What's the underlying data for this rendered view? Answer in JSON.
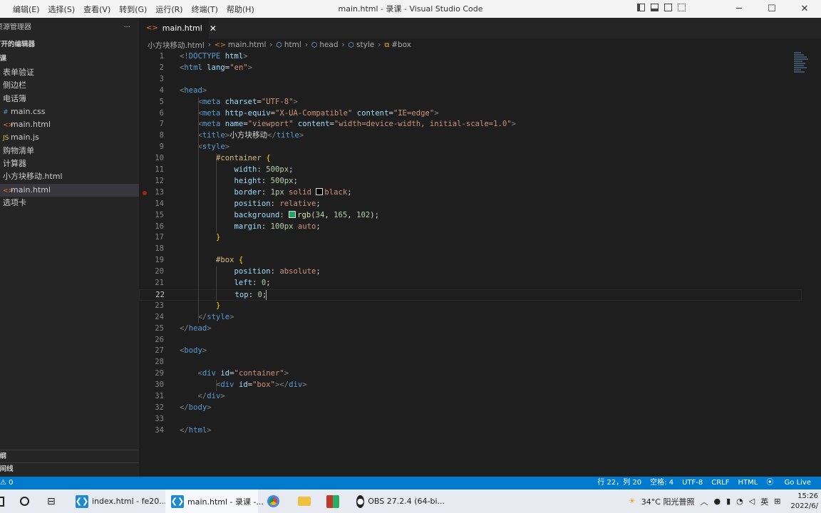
{
  "window": {
    "title": "main.html - 录课 - Visual Studio Code",
    "menu": [
      "编辑(E)",
      "选择(S)",
      "查看(V)",
      "转到(G)",
      "运行(R)",
      "终端(T)",
      "帮助(H)"
    ]
  },
  "explorer": {
    "header": "资源管理器",
    "more": "···",
    "open_editors": "打开的编辑器",
    "folder": "录课",
    "items": [
      {
        "label": "表单验证",
        "icon": "",
        "color": "#cccccc"
      },
      {
        "label": "侧边栏",
        "icon": "",
        "color": "#cccccc"
      },
      {
        "label": "电话簿",
        "icon": "",
        "color": "#cccccc"
      },
      {
        "label": "main.css",
        "icon": "#",
        "color": "#519aba"
      },
      {
        "label": "main.html",
        "icon": "<>",
        "color": "#e37933"
      },
      {
        "label": "main.js",
        "icon": "JS",
        "color": "#cbcb41"
      },
      {
        "label": "购物清单",
        "icon": "",
        "color": "#cccccc"
      },
      {
        "label": "计算器",
        "icon": "",
        "color": "#cccccc"
      },
      {
        "label": "小方块移动.html",
        "icon": "",
        "color": "#cccccc"
      },
      {
        "label": "main.html",
        "icon": "<>",
        "color": "#e37933"
      },
      {
        "label": "选项卡",
        "icon": "",
        "color": "#cccccc"
      }
    ],
    "selected_index": 9,
    "outline": "大纲",
    "timeline": "时间线"
  },
  "tabs": [
    {
      "label": "main.html",
      "close": "✕"
    }
  ],
  "breadcrumb": [
    "小方块移动.html",
    "main.html",
    "html",
    "head",
    "style",
    "#box"
  ],
  "editor": {
    "current_line": 22,
    "breakpoint_line": 13,
    "lines": [
      [
        [
          "t-br",
          "<!"
        ],
        [
          "t-tag",
          "DOCTYPE "
        ],
        [
          "t-attr",
          "html"
        ],
        [
          "t-br",
          ">"
        ]
      ],
      [
        [
          "t-br",
          "<"
        ],
        [
          "t-tag",
          "html "
        ],
        [
          "t-attr",
          "lang"
        ],
        [
          "t-p",
          "="
        ],
        [
          "t-str",
          "\"en\""
        ],
        [
          "t-br",
          ">"
        ]
      ],
      [],
      [
        [
          "t-br",
          "<"
        ],
        [
          "t-tag",
          "head"
        ],
        [
          "t-br",
          ">"
        ]
      ],
      [
        [
          "t-p",
          "    "
        ],
        [
          "t-br",
          "<"
        ],
        [
          "t-tag",
          "meta "
        ],
        [
          "t-attr",
          "charset"
        ],
        [
          "t-p",
          "="
        ],
        [
          "t-str",
          "\"UTF-8\""
        ],
        [
          "t-br",
          ">"
        ]
      ],
      [
        [
          "t-p",
          "    "
        ],
        [
          "t-br",
          "<"
        ],
        [
          "t-tag",
          "meta "
        ],
        [
          "t-attr",
          "http-equiv"
        ],
        [
          "t-p",
          "="
        ],
        [
          "t-str",
          "\"X-UA-Compatible\""
        ],
        [
          "t-p",
          " "
        ],
        [
          "t-attr",
          "content"
        ],
        [
          "t-p",
          "="
        ],
        [
          "t-str",
          "\"IE=edge\""
        ],
        [
          "t-br",
          ">"
        ]
      ],
      [
        [
          "t-p",
          "    "
        ],
        [
          "t-br",
          "<"
        ],
        [
          "t-tag",
          "meta "
        ],
        [
          "t-attr",
          "name"
        ],
        [
          "t-p",
          "="
        ],
        [
          "t-str",
          "\"viewport\""
        ],
        [
          "t-p",
          " "
        ],
        [
          "t-attr",
          "content"
        ],
        [
          "t-p",
          "="
        ],
        [
          "t-str",
          "\"width=device-width, initial-scale=1.0\""
        ],
        [
          "t-br",
          ">"
        ]
      ],
      [
        [
          "t-p",
          "    "
        ],
        [
          "t-br",
          "<"
        ],
        [
          "t-tag",
          "title"
        ],
        [
          "t-br",
          ">"
        ],
        [
          "t-txt",
          "小方块移动"
        ],
        [
          "t-br",
          "</"
        ],
        [
          "t-tag",
          "title"
        ],
        [
          "t-br",
          ">"
        ]
      ],
      [
        [
          "t-p",
          "    "
        ],
        [
          "t-br",
          "<"
        ],
        [
          "t-tag",
          "style"
        ],
        [
          "t-br",
          ">"
        ]
      ],
      [
        [
          "t-p",
          "        "
        ],
        [
          "t-sel",
          "#container "
        ],
        [
          "t-curly",
          "{"
        ]
      ],
      [
        [
          "t-p",
          "            "
        ],
        [
          "t-prop",
          "width"
        ],
        [
          "t-p",
          ": "
        ],
        [
          "t-num",
          "500px"
        ],
        [
          "t-p",
          ";"
        ]
      ],
      [
        [
          "t-p",
          "            "
        ],
        [
          "t-prop",
          "height"
        ],
        [
          "t-p",
          ": "
        ],
        [
          "t-num",
          "500px"
        ],
        [
          "t-p",
          ";"
        ]
      ],
      [
        [
          "t-p",
          "            "
        ],
        [
          "t-prop",
          "border"
        ],
        [
          "t-p",
          ": "
        ],
        [
          "t-num",
          "1px "
        ],
        [
          "t-val",
          "solid "
        ],
        [
          "sw-black",
          ""
        ],
        [
          "t-val",
          "black"
        ],
        [
          "t-p",
          ";"
        ]
      ],
      [
        [
          "t-p",
          "            "
        ],
        [
          "t-prop",
          "position"
        ],
        [
          "t-p",
          ": "
        ],
        [
          "t-val",
          "relative"
        ],
        [
          "t-p",
          ";"
        ]
      ],
      [
        [
          "t-p",
          "            "
        ],
        [
          "t-prop",
          "background"
        ],
        [
          "t-p",
          ": "
        ],
        [
          "sw-green",
          ""
        ],
        [
          "t-fn",
          "rgb"
        ],
        [
          "t-p",
          "("
        ],
        [
          "t-num",
          "34"
        ],
        [
          "t-p",
          ", "
        ],
        [
          "t-num",
          "165"
        ],
        [
          "t-p",
          ", "
        ],
        [
          "t-num",
          "102"
        ],
        [
          "t-p",
          ");"
        ]
      ],
      [
        [
          "t-p",
          "            "
        ],
        [
          "t-prop",
          "margin"
        ],
        [
          "t-p",
          ": "
        ],
        [
          "t-num",
          "100px "
        ],
        [
          "t-val",
          "auto"
        ],
        [
          "t-p",
          ";"
        ]
      ],
      [
        [
          "t-p",
          "        "
        ],
        [
          "t-curly",
          "}"
        ]
      ],
      [],
      [
        [
          "t-p",
          "        "
        ],
        [
          "t-sel",
          "#box "
        ],
        [
          "t-curly",
          "{"
        ]
      ],
      [
        [
          "t-p",
          "            "
        ],
        [
          "t-prop",
          "position"
        ],
        [
          "t-p",
          ": "
        ],
        [
          "t-val",
          "absolute"
        ],
        [
          "t-p",
          ";"
        ]
      ],
      [
        [
          "t-p",
          "            "
        ],
        [
          "t-prop",
          "left"
        ],
        [
          "t-p",
          ": "
        ],
        [
          "t-num",
          "0"
        ],
        [
          "t-p",
          ";"
        ]
      ],
      [
        [
          "t-p",
          "            "
        ],
        [
          "t-prop",
          "top"
        ],
        [
          "t-p",
          ": "
        ],
        [
          "t-num",
          "0"
        ],
        [
          "t-p",
          ";"
        ]
      ],
      [
        [
          "t-p",
          "        "
        ],
        [
          "t-curly",
          "}"
        ]
      ],
      [
        [
          "t-p",
          "    "
        ],
        [
          "t-br",
          "</"
        ],
        [
          "t-tag",
          "style"
        ],
        [
          "t-br",
          ">"
        ]
      ],
      [
        [
          "t-br",
          "</"
        ],
        [
          "t-tag",
          "head"
        ],
        [
          "t-br",
          ">"
        ]
      ],
      [],
      [
        [
          "t-br",
          "<"
        ],
        [
          "t-tag",
          "body"
        ],
        [
          "t-br",
          ">"
        ]
      ],
      [],
      [
        [
          "t-p",
          "    "
        ],
        [
          "t-br",
          "<"
        ],
        [
          "t-tag",
          "div "
        ],
        [
          "t-attr",
          "id"
        ],
        [
          "t-p",
          "="
        ],
        [
          "t-str",
          "\"container\""
        ],
        [
          "t-br",
          ">"
        ]
      ],
      [
        [
          "t-p",
          "        "
        ],
        [
          "t-br",
          "<"
        ],
        [
          "t-tag",
          "div "
        ],
        [
          "t-attr",
          "id"
        ],
        [
          "t-p",
          "="
        ],
        [
          "t-str",
          "\"box\""
        ],
        [
          "t-br",
          "></"
        ],
        [
          "t-tag",
          "div"
        ],
        [
          "t-br",
          ">"
        ]
      ],
      [
        [
          "t-p",
          "    "
        ],
        [
          "t-br",
          "</"
        ],
        [
          "t-tag",
          "div"
        ],
        [
          "t-br",
          ">"
        ]
      ],
      [
        [
          "t-br",
          "</"
        ],
        [
          "t-tag",
          "body"
        ],
        [
          "t-br",
          ">"
        ]
      ],
      [],
      [
        [
          "t-br",
          "</"
        ],
        [
          "t-tag",
          "html"
        ],
        [
          "t-br",
          ">"
        ]
      ]
    ]
  },
  "status": {
    "left": "⚠ 0",
    "position": "行 22，列 20",
    "spaces": "空格: 4",
    "encoding": "UTF-8",
    "eol": "CRLF",
    "language": "HTML",
    "golive": "Go Live"
  },
  "taskbar": {
    "items": [
      {
        "label": "index.html - fe20...",
        "icon": "vscode-icon"
      },
      {
        "label": "main.html - 录课 -...",
        "icon": "vscode-icon",
        "active": true
      },
      {
        "label": "OBS 27.2.4 (64-bi...",
        "icon": "obs-icon"
      }
    ],
    "weather": "34°C 阳光普照",
    "ime": "英",
    "time": "15:26",
    "date": "2022/6/"
  },
  "colors": {
    "accent": "#007acc",
    "green_swatch": "#22a566",
    "black_swatch": "#000000"
  }
}
